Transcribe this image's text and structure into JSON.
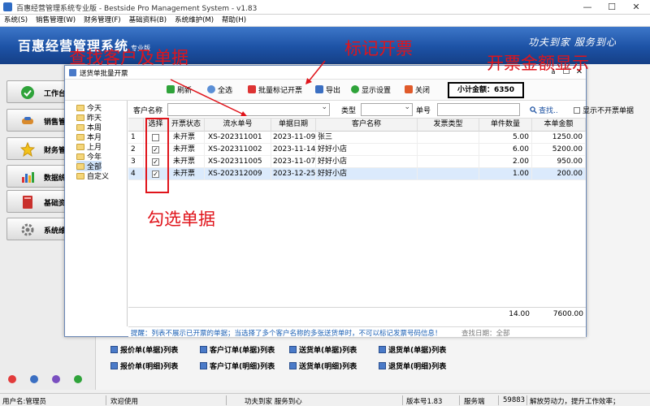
{
  "window": {
    "title": "百惠经营管理系统专业版 - Bestside Pro Management System - v1.83",
    "minimize": "—",
    "maximize": "☐",
    "close": "✕"
  },
  "menu": [
    "系统(S)",
    "销售管理(W)",
    "财务管理(F)",
    "基础资料(B)",
    "系统维护(M)",
    "帮助(H)"
  ],
  "banner": {
    "logo": "百惠经营管理系统",
    "edition": "专业版",
    "slogan": "功夫到家  服务到心"
  },
  "sidebar": {
    "items": [
      {
        "label": "工作台",
        "icon": "check-icon"
      },
      {
        "label": "销售管理",
        "icon": "handshake-icon"
      },
      {
        "label": "财务管理",
        "icon": "star-icon"
      },
      {
        "label": "数据统计",
        "icon": "bar-chart-icon"
      },
      {
        "label": "基础资料",
        "icon": "book-icon"
      },
      {
        "label": "系统维护",
        "icon": "gear-icon"
      }
    ]
  },
  "shortcuts": {
    "row1": [
      "报价单(单据)列表",
      "客户订单(单据)列表",
      "送货单(单据)列表",
      "退货单(单据)列表"
    ],
    "row2": [
      "报价单(明细)列表",
      "客户订单(明细)列表",
      "送货单(明细)列表",
      "退货单(明细)列表"
    ]
  },
  "statusbar": {
    "user": "用户名:管理员",
    "welcome": "欢迎使用",
    "motto": "功夫到家 服务到心",
    "version": "版本号1.83",
    "server": "服务端",
    "port": "59883",
    "tagline": "解放劳动力，提升工作效率；"
  },
  "dialog": {
    "title": "送货单批量开票",
    "window_chars": "ă",
    "toolbar": {
      "refresh": "刷新",
      "select_all": "全选",
      "batch_mark": "批量标记开票",
      "export": "导出",
      "display_settings": "显示设置",
      "close": "关闭"
    },
    "subtotal_label": "小计金额：",
    "subtotal_value": "6350",
    "tree": [
      "今天",
      "昨天",
      "本周",
      "本月",
      "上月",
      "今年",
      "全部",
      "自定义"
    ],
    "tree_selected": "全部",
    "filters": {
      "customer_label": "客户名称",
      "type_label": "类型",
      "doc_no_label": "单号",
      "search_button": "查找..",
      "hide_invoiced_label": "显示不开票单据"
    },
    "table": {
      "columns": [
        "选择",
        "开票状态",
        "流水单号",
        "单据日期",
        "客户名称",
        "发票类型",
        "单件数量",
        "本单金额"
      ],
      "rows": [
        {
          "no": "1",
          "checked": false,
          "status": "未开票",
          "serial": "XS-202311001",
          "date": "2023-11-09",
          "customer": "张三",
          "invoice_type": "",
          "qty": "5.00",
          "amount": "1250.00"
        },
        {
          "no": "2",
          "checked": true,
          "status": "未开票",
          "serial": "XS-202311002",
          "date": "2023-11-14",
          "customer": "好好小店",
          "invoice_type": "",
          "qty": "6.00",
          "amount": "5200.00"
        },
        {
          "no": "3",
          "checked": true,
          "status": "未开票",
          "serial": "XS-202311005",
          "date": "2023-11-07",
          "customer": "好好小店",
          "invoice_type": "",
          "qty": "2.00",
          "amount": "950.00"
        },
        {
          "no": "4",
          "checked": true,
          "status": "未开票",
          "serial": "XS-202312009",
          "date": "2023-12-25",
          "customer": "好好小店",
          "invoice_type": "",
          "qty": "1.00",
          "amount": "200.00"
        }
      ],
      "total_qty": "14.00",
      "total_amount": "7600.00"
    },
    "hint": "提醒：列表不展示已开票的单据；当选择了多个客户名称的多张送货单时，不可以标记发票号码信息！",
    "hint_range": "查找日期：全部"
  },
  "annotations": {
    "find_customer": "查找客户及单据",
    "mark_invoice": "标记开票",
    "amount_display": "开票金额显示",
    "check_docs": "勾选单据"
  },
  "colors": {
    "banner": "#1d52a5",
    "annotation": "#e0141b",
    "row_highlight": "#dbeafc"
  }
}
